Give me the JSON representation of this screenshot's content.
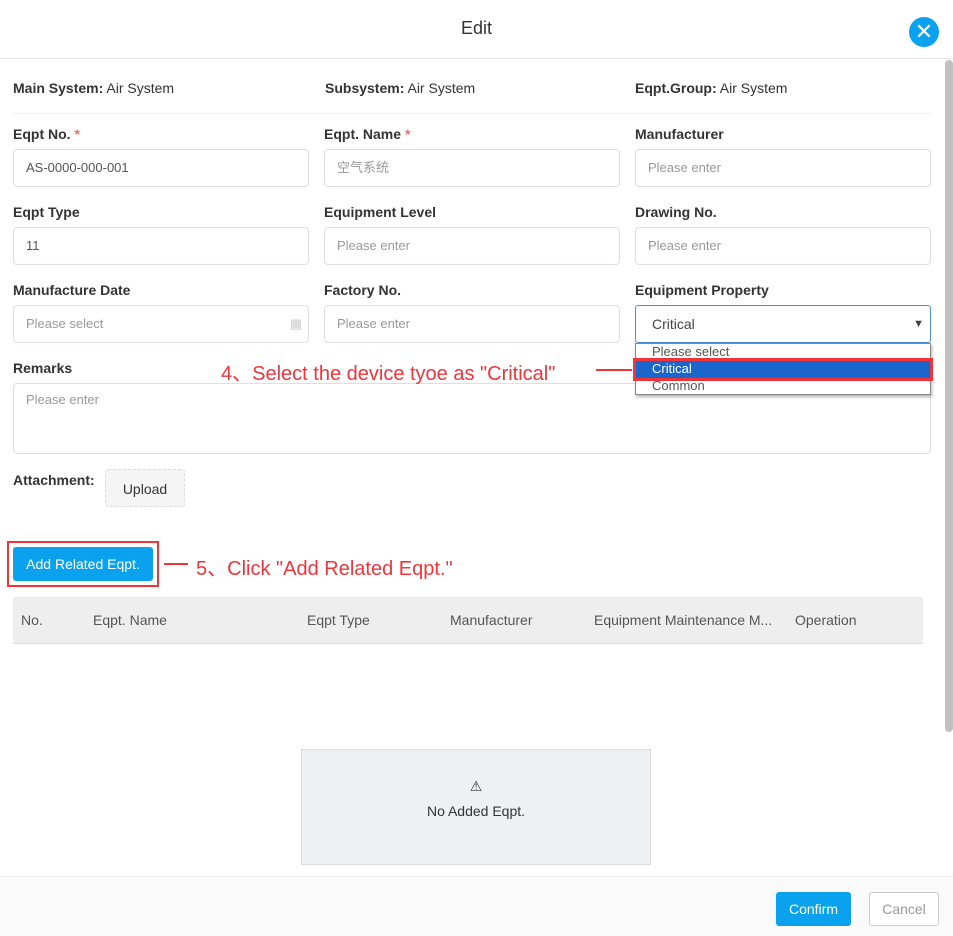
{
  "dialog": {
    "title": "Edit",
    "close_icon": "close-icon"
  },
  "info": {
    "main_system_label": "Main System:",
    "main_system": "Air System",
    "subsystem_label": "Subsystem:",
    "subsystem": "Air System",
    "group_label": "Eqpt.Group:",
    "group": "Air System"
  },
  "fields": {
    "eqpt_no": {
      "label": "Eqpt No.",
      "value": "AS-0000-000-001"
    },
    "eqpt_name": {
      "label": "Eqpt. Name",
      "placeholder": "空气系统"
    },
    "manufacturer": {
      "label": "Manufacturer",
      "placeholder": "Please enter"
    },
    "eqpt_type": {
      "label": "Eqpt Type",
      "value": "11"
    },
    "equipment_level": {
      "label": "Equipment Level",
      "placeholder": "Please enter"
    },
    "drawing_no": {
      "label": "Drawing No.",
      "placeholder": "Please enter"
    },
    "manufacture_date": {
      "label": "Manufacture Date",
      "placeholder": "Please select"
    },
    "factory_no": {
      "label": "Factory No.",
      "placeholder": "Please enter"
    },
    "equipment_property": {
      "label": "Equipment Property",
      "value": "Critical",
      "options": [
        "Please select",
        "Critical",
        "Common"
      ]
    },
    "remarks": {
      "label": "Remarks",
      "placeholder": "Please enter"
    },
    "attachment": {
      "label": "Attachment:",
      "upload": "Upload"
    }
  },
  "required_mark": "*",
  "annotations": {
    "step4": "4、Select the device tyoe as \"Critical\"",
    "step5": "5、Click \"Add Related Eqpt.\""
  },
  "add_related": "Add Related Eqpt.",
  "table": {
    "columns": [
      "No.",
      "Eqpt. Name",
      "Eqpt Type",
      "Manufacturer",
      "Equipment Maintenance M...",
      "Operation"
    ],
    "empty_text": "No Added Eqpt.",
    "empty_icon": "⚠"
  },
  "footer": {
    "confirm": "Confirm",
    "cancel": "Cancel"
  },
  "colors": {
    "accent": "#0aa2ee",
    "annotation": "#f0343a"
  }
}
